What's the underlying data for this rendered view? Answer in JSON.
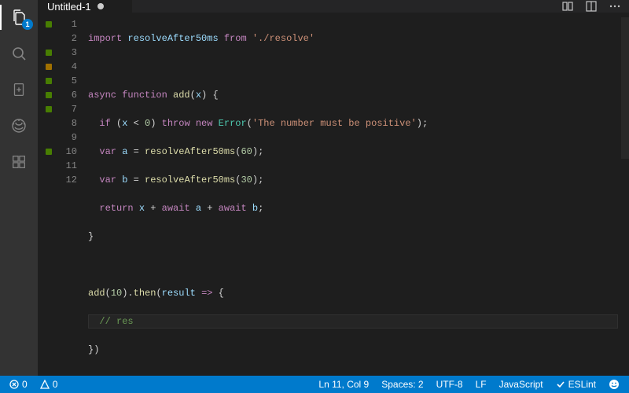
{
  "activitybar": {
    "explorer_badge": "1"
  },
  "tab": {
    "title": "Untitled-1"
  },
  "gutter": [
    {
      "n": "1",
      "mark": "green"
    },
    {
      "n": "2",
      "mark": ""
    },
    {
      "n": "3",
      "mark": "green"
    },
    {
      "n": "4",
      "mark": "yellow"
    },
    {
      "n": "5",
      "mark": "green"
    },
    {
      "n": "6",
      "mark": "green"
    },
    {
      "n": "7",
      "mark": "green"
    },
    {
      "n": "8",
      "mark": ""
    },
    {
      "n": "9",
      "mark": ""
    },
    {
      "n": "10",
      "mark": "green"
    },
    {
      "n": "11",
      "mark": ""
    },
    {
      "n": "12",
      "mark": ""
    }
  ],
  "code": {
    "l1": {
      "import": "import",
      "id1": "resolveAfter50ms",
      "from": "from",
      "str": "'./resolve'"
    },
    "l3": {
      "async": "async",
      "function": "function",
      "name": "add",
      "param": "x"
    },
    "l4": {
      "if": "if",
      "param": "x",
      "lt": "<",
      "zero": "0",
      "throw": "throw",
      "new": "new",
      "err": "Error",
      "msg": "'The number must be positive'"
    },
    "l5": {
      "var": "var",
      "a": "a",
      "fn": "resolveAfter50ms",
      "arg": "60"
    },
    "l6": {
      "var": "var",
      "b": "b",
      "fn": "resolveAfter50ms",
      "arg": "30"
    },
    "l7": {
      "return": "return",
      "x": "x",
      "plus": "+",
      "await": "await",
      "a": "a",
      "b": "b"
    },
    "l10": {
      "add": "add",
      "ten": "10",
      "then": "then",
      "res": "result",
      "arrow": "=>"
    },
    "l11": {
      "cmt": "// res"
    },
    "brace_open": "{",
    "brace_close": "}",
    "paren_open": "(",
    "paren_close": ")",
    "semi": ";",
    "comma": ",",
    "dot": ".",
    "eq": "="
  },
  "status": {
    "errors": "0",
    "warnings": "0",
    "cursor": "Ln 11, Col 9",
    "spaces": "Spaces: 2",
    "encoding": "UTF-8",
    "eol": "LF",
    "language": "JavaScript",
    "eslint": "ESLint"
  }
}
